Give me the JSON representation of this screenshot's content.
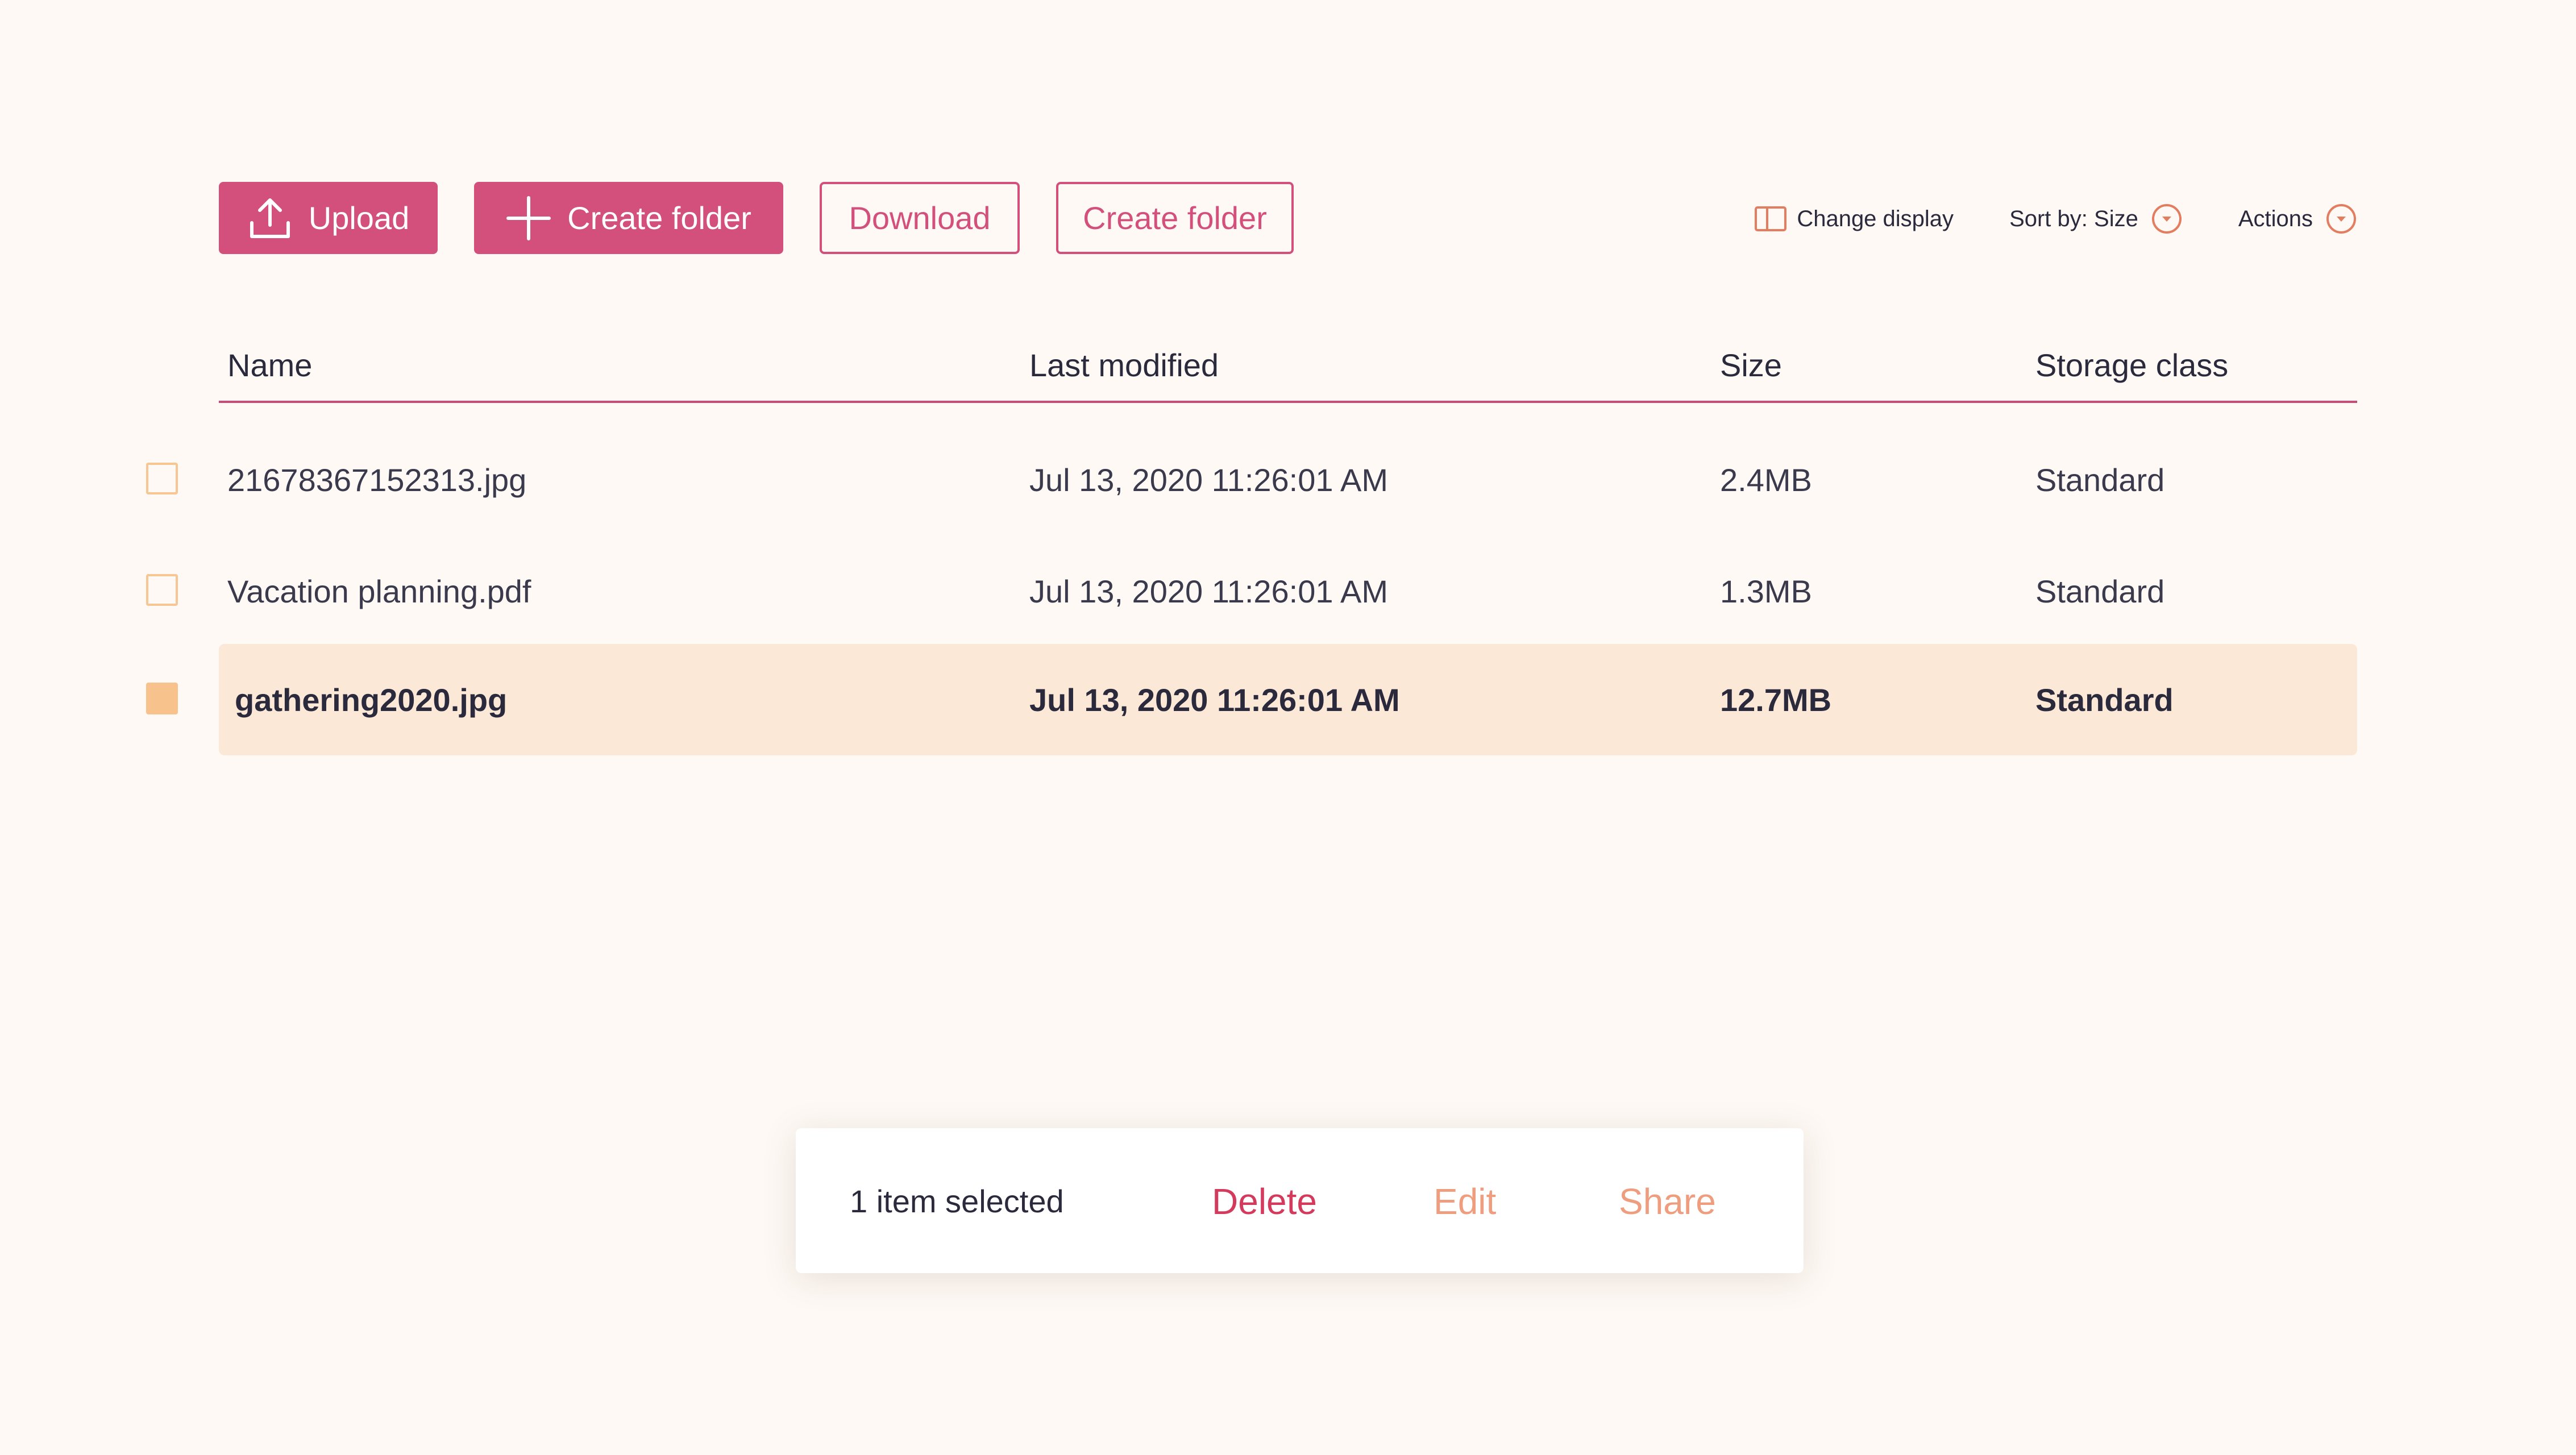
{
  "toolbar": {
    "upload_label": "Upload",
    "create_folder_primary_label": "Create folder",
    "download_label": "Download",
    "create_folder_outline_label": "Create folder",
    "change_display_label": "Change display",
    "sort_label": "Sort by: Size",
    "actions_label": "Actions"
  },
  "table": {
    "headers": {
      "name": "Name",
      "last_modified": "Last modified",
      "size": "Size",
      "storage_class": "Storage class"
    },
    "rows": [
      {
        "name": "21678367152313.jpg",
        "last_modified": "Jul 13, 2020 11:26:01 AM",
        "size": "2.4MB",
        "storage_class": "Standard",
        "selected": false
      },
      {
        "name": "Vacation planning.pdf",
        "last_modified": "Jul 13, 2020 11:26:01 AM",
        "size": "1.3MB",
        "storage_class": "Standard",
        "selected": false
      },
      {
        "name": "gathering2020.jpg",
        "last_modified": "Jul 13, 2020 11:26:01 AM",
        "size": "12.7MB",
        "storage_class": "Standard",
        "selected": true
      }
    ]
  },
  "selection_bar": {
    "count_text": "1 item selected",
    "delete_label": "Delete",
    "edit_label": "Edit",
    "share_label": "Share"
  },
  "icons": {
    "upload": "upload-icon",
    "plus": "plus-icon",
    "change_display": "columns-icon",
    "sort_dropdown": "chevron-circle-down-icon",
    "actions_dropdown": "chevron-circle-down-icon"
  },
  "colors": {
    "background": "#fef9f5",
    "primary": "#d3507d",
    "header_rule": "#c94a78",
    "selected_row": "#fbe8d7",
    "checkbox": "#f6c695",
    "delete": "#d33a5c",
    "secondary_action": "#ee9e7f",
    "dropdown_icon": "#e27d60"
  }
}
